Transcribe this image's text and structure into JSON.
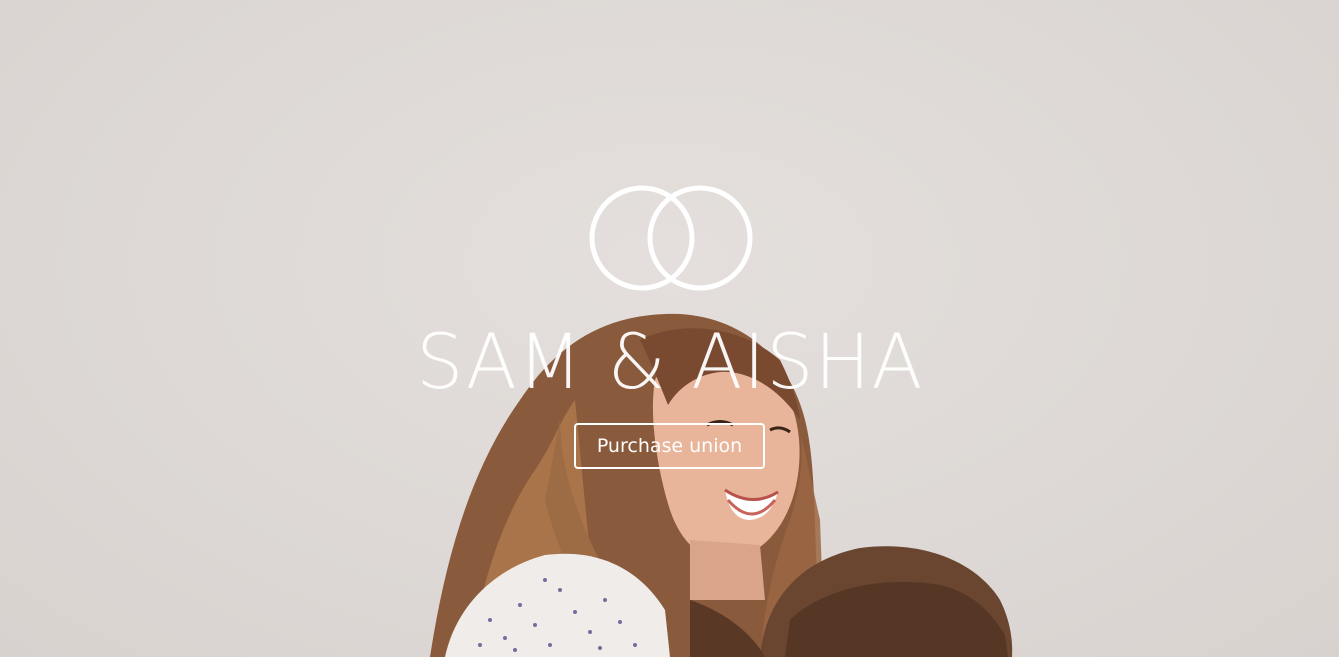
{
  "hero": {
    "couple_names": "SAM & AISHA",
    "cta_label": "Purchase union",
    "logo_icon": "wedding-rings-icon",
    "background_image": "couple-photo-overcast-sky"
  },
  "colors": {
    "sky": "#dfdad7",
    "text": "#ffffff"
  }
}
